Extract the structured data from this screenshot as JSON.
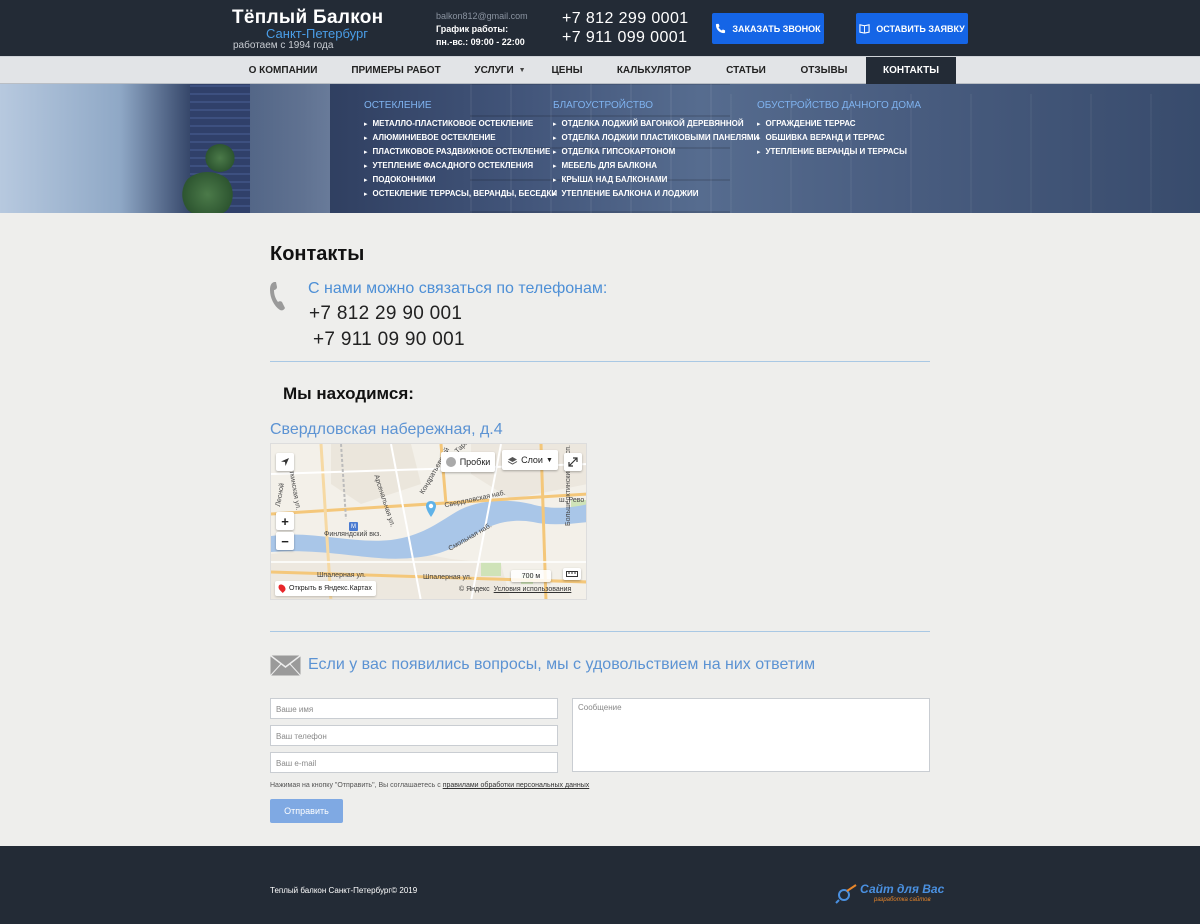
{
  "header": {
    "brand_title": "Тёплый Балкон",
    "brand_city": "Санкт-Петербург",
    "brand_since": "работаем с 1994 года",
    "email": "balkon812@gmail.com",
    "schedule_label": "График работы:",
    "schedule_value": "пн.-вс.: 09:00 - 22:00",
    "phone_1": "+7 812 299 0001",
    "phone_2": "+7 911  099 0001",
    "call_button": "Заказать звонок",
    "order_button": "Оставить заявку"
  },
  "nav": {
    "items": [
      {
        "label": "О компании"
      },
      {
        "label": "Примеры работ"
      },
      {
        "label": "Услуги"
      },
      {
        "label": "Цены"
      },
      {
        "label": "Калькулятор"
      },
      {
        "label": "Статьи"
      },
      {
        "label": "Отзывы"
      },
      {
        "label": "Контакты"
      }
    ],
    "active": "Контакты"
  },
  "mega_menu": {
    "columns": [
      {
        "title": "Остекление",
        "items": [
          "Металло-пластиковое остекление",
          "Алюминиевое остекление",
          "Пластиковое раздвижное остекление",
          "Утепление фасадного остекления",
          "Подоконники",
          "Остекление террасы, веранды, беседки"
        ]
      },
      {
        "title": "Благоустройство",
        "items": [
          "Отделка лоджий вагонкой деревянной",
          "Отделка лоджии пластиковыми панелями",
          "Отделка гипсокартоном",
          "Мебель для балкона",
          "Крыша над балконами",
          "Утепление балкона и лоджии"
        ]
      },
      {
        "title": "Обустройство дачного дома",
        "items": [
          "Ограждение террас",
          "Обшивка веранд и террас",
          "Утепление веранды и террасы"
        ]
      }
    ]
  },
  "main": {
    "title": "Контакты",
    "phones_heading": "С нами можно связаться по телефонам:",
    "phone_1": "+7 812 29 90 001",
    "phone_2": "+7 911 09 90 001",
    "location_title": "Мы находимся:",
    "address": "Свердловская набережная, д.4"
  },
  "map": {
    "traffic_label": "Пробки",
    "layers_label": "Слои",
    "open_label": "Открыть в Яндекс.Картах",
    "copyright": "© Яндекс",
    "terms_label": "Условия использования",
    "scale_label": "700 м",
    "street_labels": {
      "sverdlovskaya": "Свердловская наб.",
      "smolnaya": "Смольная наб.",
      "finlyandsky": "Финляндский вкз.",
      "shpalernaya_1": "Шпалерная ул.",
      "shpalernaya_2": "Шпалерная ул.",
      "revolution": "ш. Рево",
      "arsenalnaya": "Арсенальная ул.",
      "kondratyevsky": "Кондратьевский",
      "botkinskaya": "Боткинская ул.",
      "bolsheokhtinsky": "Большеохтинский просп.",
      "tarasova": "Тарасова",
      "lesnoy": "Лесной"
    }
  },
  "contact_form": {
    "heading": "Если у вас появились вопросы, мы с удовольствием на них ответим",
    "name_placeholder": "Ваше имя",
    "phone_placeholder": "Ваш телефон",
    "email_placeholder": "Ваш e-mail",
    "message_placeholder": "Сообщение",
    "consent_text": "Нажимая на кнопку \"Отправить\", Вы соглашаетесь с ",
    "consent_link": "правилами обработки персональных данных",
    "submit_label": "Отправить"
  },
  "footer": {
    "copyright": "Теплый балкон Санкт-Петербург© 2019",
    "developer_name": "Сайт для Вас",
    "developer_tagline": "разработка сайтов"
  },
  "colors": {
    "header_bg": "#232b36",
    "accent_blue": "#1565e6",
    "link_blue": "#5c93d3",
    "submit_bg": "#7fa9e3"
  }
}
